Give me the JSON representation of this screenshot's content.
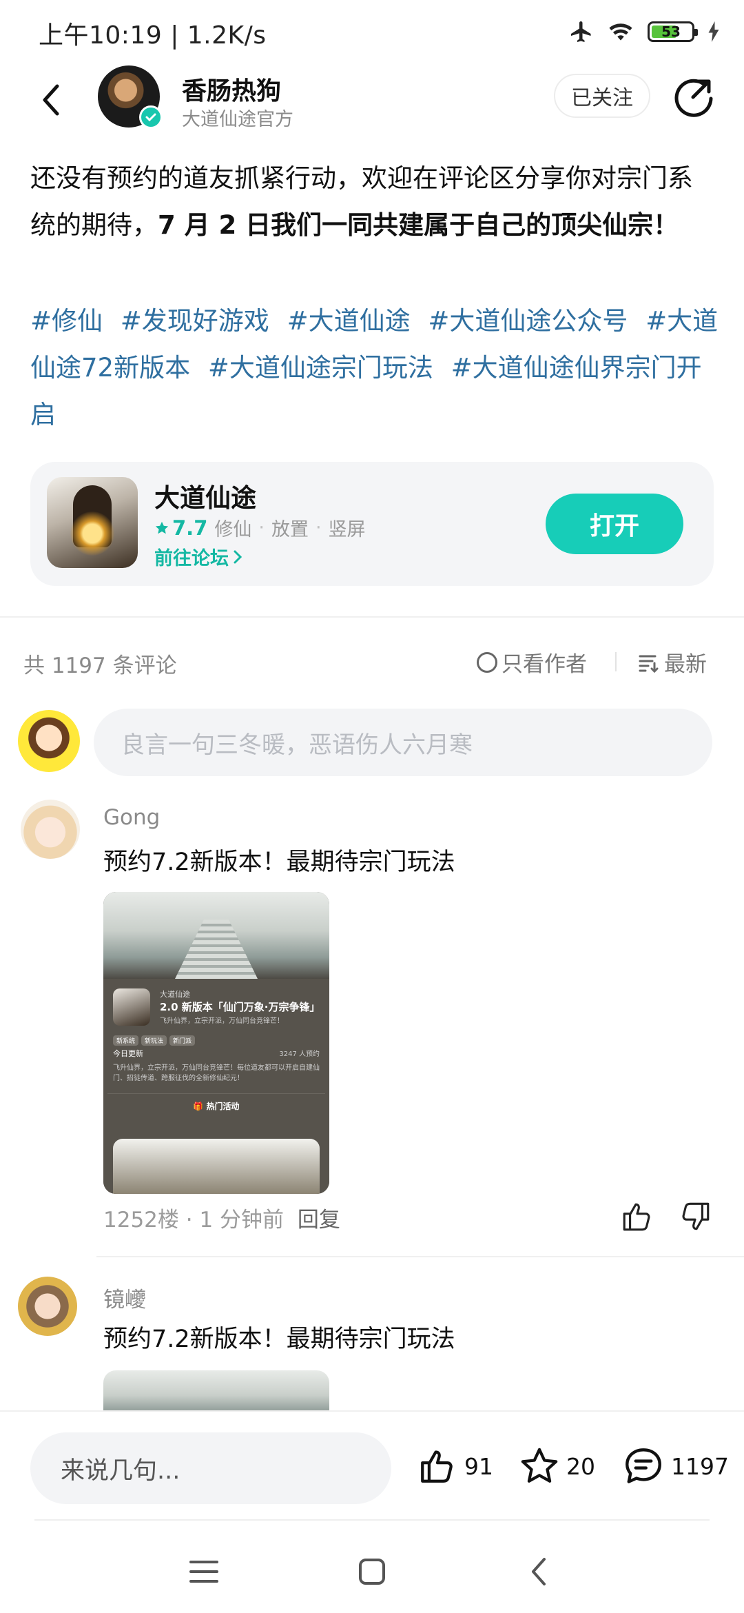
{
  "status_bar": {
    "time": "上午10:19 | 1.2K/s",
    "battery": "53"
  },
  "header": {
    "author_name": "香肠热狗",
    "author_subtitle": "大道仙途官方",
    "follow_label": "已关注"
  },
  "post": {
    "text_part1": "还没有预约的道友抓紧行动，欢迎在评论区分享你对宗门系统的期待，",
    "text_part2": "7 月 2 日我们一同共建属于自己的顶尖仙宗！",
    "tags": [
      "#修仙",
      "#发现好游戏",
      "#大道仙途",
      "#大道仙途公众号",
      "#大道仙途72新版本",
      "#大道仙途宗门玩法",
      "#大道仙途仙界宗门开启"
    ]
  },
  "game_card": {
    "title": "大道仙途",
    "rating": "7.7",
    "tags": [
      "修仙",
      "放置",
      "竖屏"
    ],
    "forum_link": "前往论坛",
    "open_label": "打开",
    "accent_color": "#17cdb8"
  },
  "comments_header": {
    "count_text": "共 1197 条评论",
    "author_only": "只看作者",
    "sort_label": "最新"
  },
  "comment_input": {
    "placeholder": "良言一句三冬暖，恶语伤人六月寒"
  },
  "comments": [
    {
      "name": "Gong",
      "text": "预约7.2新版本！最期待宗门玩法",
      "image": {
        "brand": "大道仙途",
        "title": "2.0 新版本「仙门万象·万宗争锋」",
        "subtitle": "飞升仙界，立宗开派，万仙同台竞锋芒！",
        "chips": [
          "新系统",
          "新玩法",
          "新门派"
        ],
        "update_label": "今日更新",
        "reserve_count": "3247 人预约",
        "description": "飞升仙界，立宗开派，万仙同台竞锋芒！每位道友都可以开启自建仙门、招徒传道、跨服征伐的全新修仙纪元！",
        "hot_label": "热门活动"
      },
      "floor": "1252楼",
      "time": "1 分钟前",
      "reply_label": "回复"
    },
    {
      "name": "镜巙",
      "text": "预约7.2新版本！最期待宗门玩法"
    }
  ],
  "bottom_bar": {
    "say_placeholder": "来说几句...",
    "likes": "91",
    "favorites": "20",
    "comments": "1197"
  }
}
